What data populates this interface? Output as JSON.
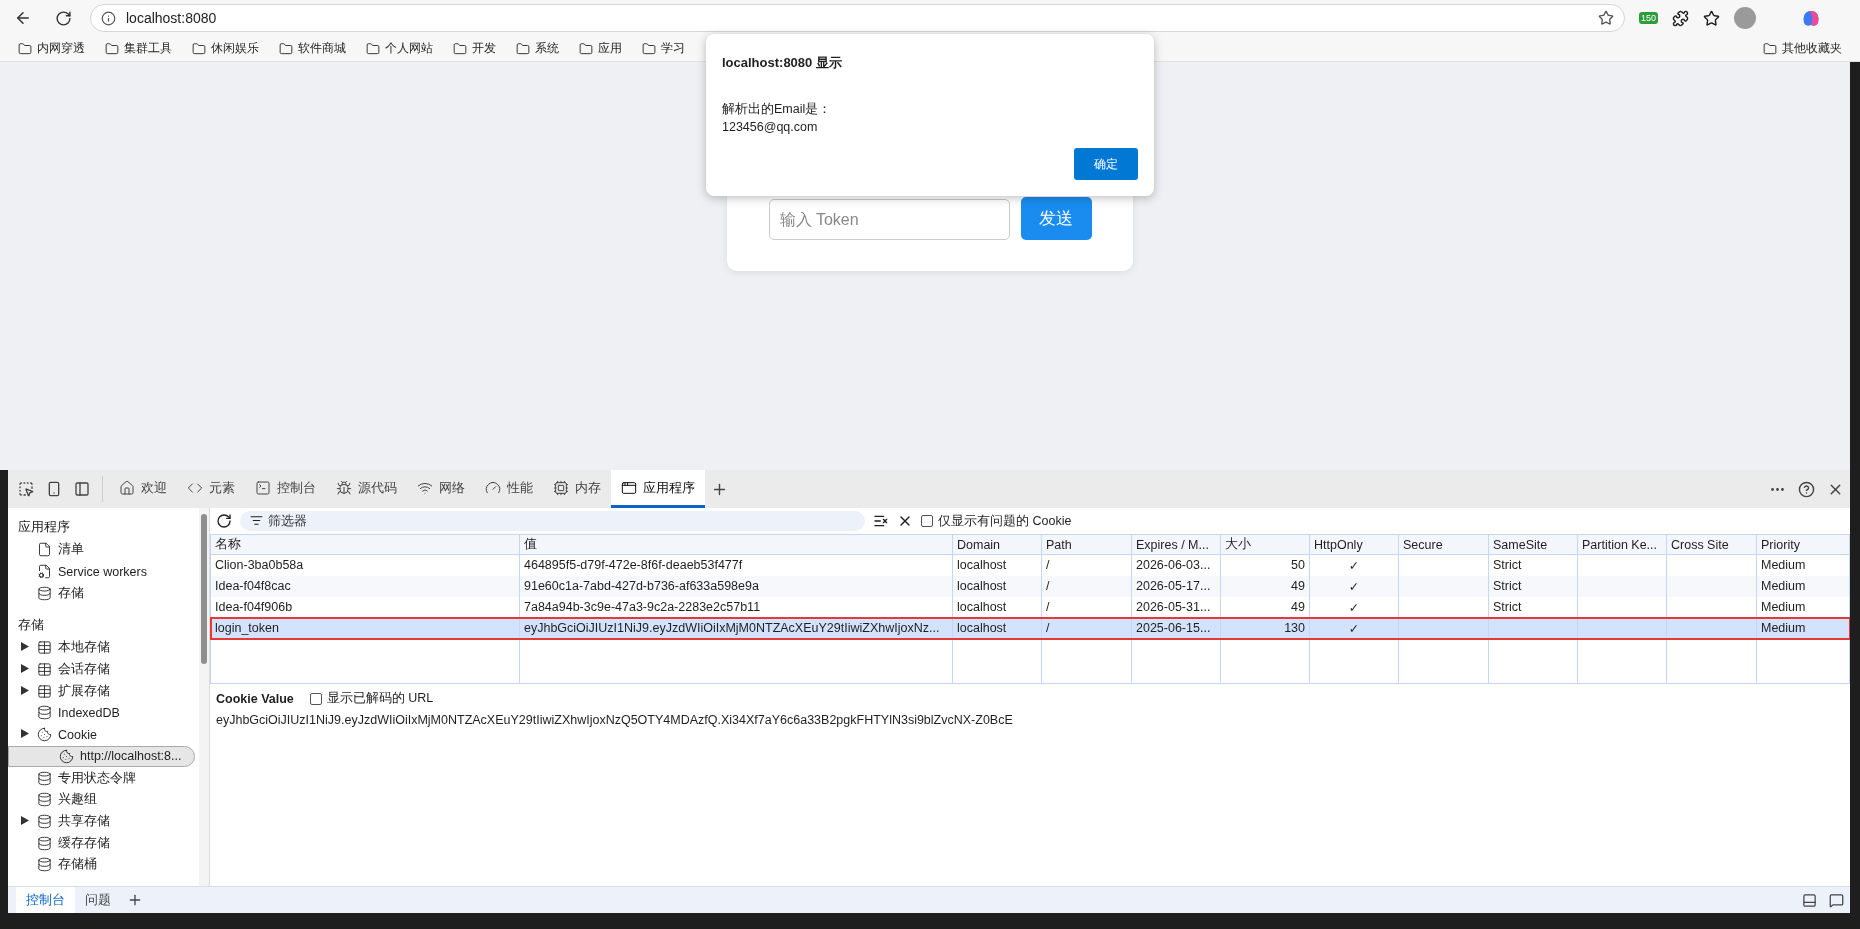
{
  "browser": {
    "address": "localhost:8080",
    "extension_badge": "150",
    "bookmarks": [
      "内网穿透",
      "集群工具",
      "休闲娱乐",
      "软件商城",
      "个人网站",
      "开发",
      "系统",
      "应用",
      "学习"
    ],
    "other_bookmarks": "其他收藏夹"
  },
  "page": {
    "token_input": {
      "placeholder": "输入 Token"
    },
    "send_button": "发送"
  },
  "dialog": {
    "title": "localhost:8080 显示",
    "message_lines": [
      "解析出的Email是：",
      "123456@qq.com"
    ],
    "ok_button": "确定"
  },
  "devtools": {
    "tabs": [
      {
        "label": "欢迎",
        "kind": "home",
        "selected": false
      },
      {
        "label": "元素",
        "kind": "code",
        "selected": false
      },
      {
        "label": "控制台",
        "kind": "console",
        "selected": false
      },
      {
        "label": "源代码",
        "kind": "bug",
        "selected": false
      },
      {
        "label": "网络",
        "kind": "wifi",
        "selected": false
      },
      {
        "label": "性能",
        "kind": "gauge",
        "selected": false
      },
      {
        "label": "内存",
        "kind": "chip",
        "selected": false
      },
      {
        "label": "应用程序",
        "kind": "app",
        "selected": true
      }
    ],
    "sidebar": [
      {
        "title": "应用程序",
        "items": [
          {
            "label": "清单",
            "kind": "file",
            "expander": false,
            "selected": false
          },
          {
            "label": "Service workers",
            "kind": "worker",
            "expander": false,
            "selected": false
          },
          {
            "label": "存储",
            "kind": "db",
            "expander": false,
            "selected": false
          }
        ]
      },
      {
        "title": "存储",
        "items": [
          {
            "label": "本地存储",
            "kind": "table",
            "expander": true,
            "selected": false
          },
          {
            "label": "会话存储",
            "kind": "table",
            "expander": true,
            "selected": false
          },
          {
            "label": "扩展存储",
            "kind": "table",
            "expander": true,
            "selected": false
          },
          {
            "label": "IndexedDB",
            "kind": "db",
            "expander": false,
            "selected": false
          },
          {
            "label": "Cookie",
            "kind": "cookie",
            "expander": true,
            "selected": false,
            "children": [
              {
                "label": "http://localhost:8...",
                "kind": "cookie",
                "expander": false,
                "selected": true
              }
            ]
          },
          {
            "label": "专用状态令牌",
            "kind": "db",
            "expander": false,
            "selected": false
          },
          {
            "label": "兴趣组",
            "kind": "db",
            "expander": false,
            "selected": false
          },
          {
            "label": "共享存储",
            "kind": "db",
            "expander": true,
            "selected": false
          },
          {
            "label": "缓存存储",
            "kind": "db",
            "expander": false,
            "selected": false
          },
          {
            "label": "存储桶",
            "kind": "db",
            "expander": false,
            "selected": false
          }
        ]
      }
    ],
    "filter": {
      "placeholder": "筛选器"
    },
    "only_issues": {
      "label": "仅显示有问题的 Cookie",
      "checked": false
    },
    "table": {
      "columns": [
        {
          "label": "名称",
          "kind": "text"
        },
        {
          "label": "值",
          "kind": "text"
        },
        {
          "label": "Domain",
          "kind": "text"
        },
        {
          "label": "Path",
          "kind": "text"
        },
        {
          "label": "Expires / M...",
          "kind": "text"
        },
        {
          "label": "大小",
          "kind": "number"
        },
        {
          "label": "HttpOnly",
          "kind": "check"
        },
        {
          "label": "Secure",
          "kind": "check"
        },
        {
          "label": "SameSite",
          "kind": "text"
        },
        {
          "label": "Partition Ke...",
          "kind": "text"
        },
        {
          "label": "Cross Site",
          "kind": "text"
        },
        {
          "label": "Priority",
          "kind": "text"
        }
      ],
      "rows": [
        {
          "selected": false,
          "cells": [
            "Clion-3ba0b58a",
            "464895f5-d79f-472e-8f6f-deaeb53f477f",
            "localhost",
            "/",
            "2026-06-03...",
            "50",
            "✓",
            "",
            "Strict",
            "",
            "",
            "Medium"
          ]
        },
        {
          "selected": false,
          "cells": [
            "Idea-f04f8cac",
            "91e60c1a-7abd-427d-b736-af633a598e9a",
            "localhost",
            "/",
            "2026-05-17...",
            "49",
            "✓",
            "",
            "Strict",
            "",
            "",
            "Medium"
          ]
        },
        {
          "selected": false,
          "cells": [
            "Idea-f04f906b",
            "7a84a94b-3c9e-47a3-9c2a-2283e2c57b11",
            "localhost",
            "/",
            "2026-05-31...",
            "49",
            "✓",
            "",
            "Strict",
            "",
            "",
            "Medium"
          ]
        },
        {
          "selected": true,
          "cells": [
            "login_token",
            "eyJhbGciOiJIUzI1NiJ9.eyJzdWIiOiIxMjM0NTZAcXEuY29tIiwiZXhwIjoxNz...",
            "localhost",
            "/",
            "2025-06-15...",
            "130",
            "✓",
            "",
            "",
            "",
            "",
            "Medium"
          ]
        }
      ]
    },
    "cookie_value": {
      "label": "Cookie Value",
      "decode": {
        "label": "显示已解码的 URL",
        "checked": false
      },
      "value": "eyJhbGciOiJIUzI1NiJ9.eyJzdWIiOiIxMjM0NTZAcXEuY29tIiwiZXhwIjoxNzQ5OTY4MDAzfQ.Xi34Xf7aY6c6a33B2pgkFHTYlN3si9blZvcNX-Z0BcE"
    },
    "drawer_tabs": [
      {
        "label": "控制台",
        "selected": true
      },
      {
        "label": "问题",
        "selected": false
      }
    ]
  }
}
